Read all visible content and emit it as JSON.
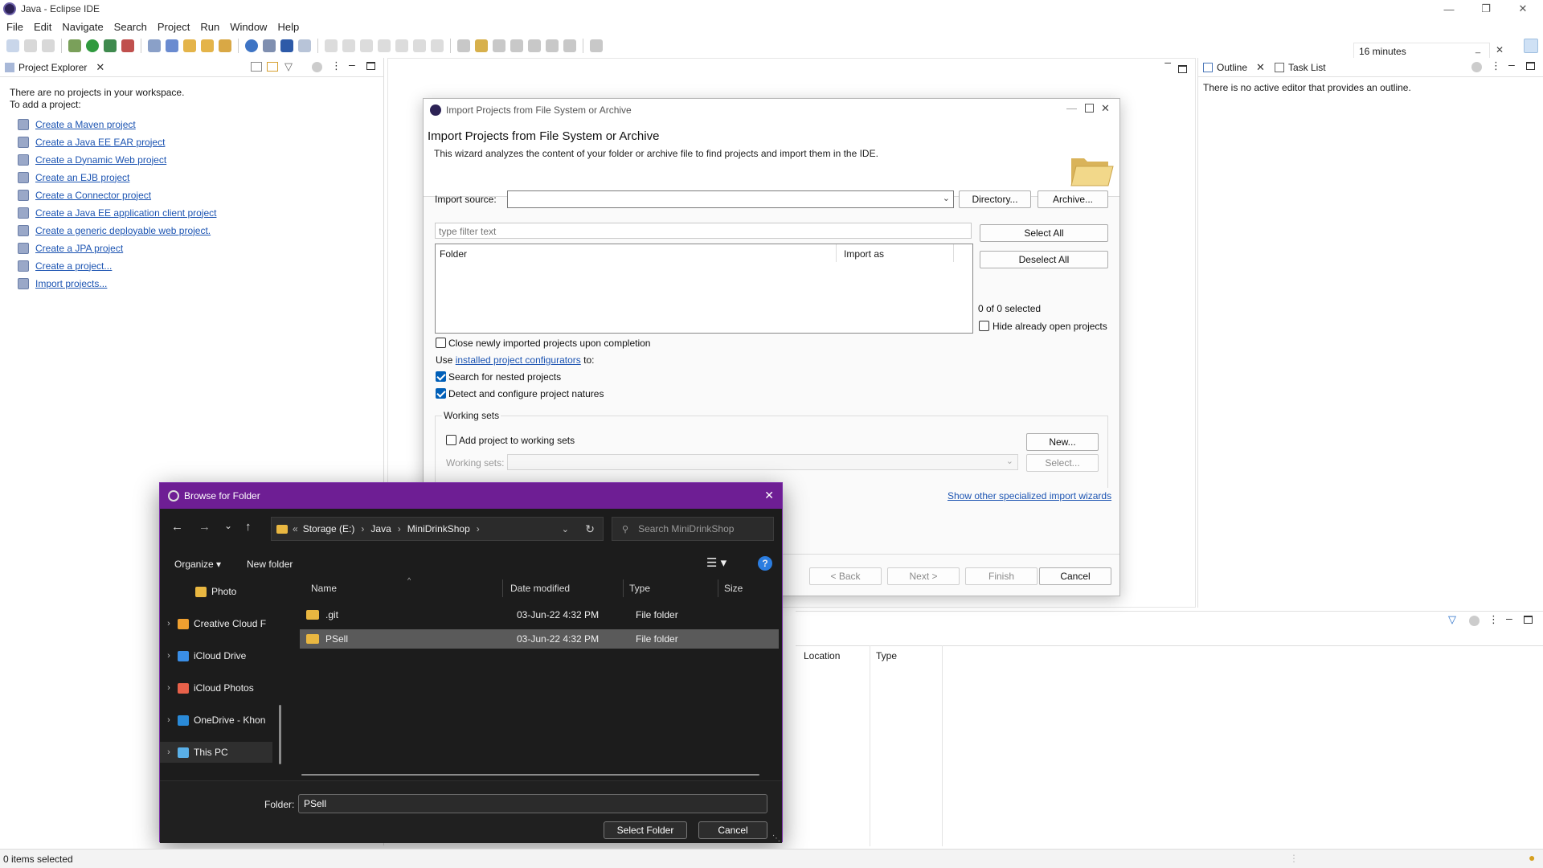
{
  "window": {
    "title": "Java - Eclipse IDE",
    "icon": "eclipse-icon"
  },
  "menu": [
    "File",
    "Edit",
    "Navigate",
    "Search",
    "Project",
    "Run",
    "Window",
    "Help"
  ],
  "quick_access": {
    "value": "16 minutes"
  },
  "project_explorer": {
    "tab_label": "Project Explorer",
    "empty_line1": "There are no projects in your workspace.",
    "empty_line2": "To add a project:",
    "links": [
      "Create a Maven project",
      "Create a Java EE EAR project",
      "Create a Dynamic Web project",
      "Create an EJB project",
      "Create a Connector project",
      "Create a Java EE application client project",
      "Create a generic deployable web project.",
      "Create a JPA project",
      "Create a project...",
      "Import projects..."
    ]
  },
  "outline": {
    "tab_outline": "Outline",
    "tab_tasks": "Task List",
    "message": "There is no active editor that provides an outline."
  },
  "bottom_panel": {
    "columns": [
      "Location",
      "Type"
    ]
  },
  "import_dialog": {
    "window_title": "Import Projects from File System or Archive",
    "heading": "Import Projects from File System or Archive",
    "description": "This wizard analyzes the content of your folder or archive file to find projects and import them in the IDE.",
    "import_source_label": "Import source:",
    "import_source_value": "",
    "directory_button": "Directory...",
    "archive_button": "Archive...",
    "filter_placeholder": "type filter text",
    "col_folder": "Folder",
    "col_import_as": "Import as",
    "select_all": "Select All",
    "deselect_all": "Deselect All",
    "selected_count": "0 of 0 selected",
    "hide_open": "Hide already open projects",
    "close_newly": "Close newly imported projects upon completion",
    "use_prefix": "Use",
    "configurators_link": "installed project configurators",
    "use_suffix": "to:",
    "search_nested": "Search for nested projects",
    "detect_natures": "Detect and configure project natures",
    "working_sets_group": "Working sets",
    "add_to_ws": "Add project to working sets",
    "new_button": "New...",
    "working_sets_label": "Working sets:",
    "select_button": "Select...",
    "other_wizards_link": "Show other specialized import wizards",
    "back_button": "< Back",
    "next_button": "Next >",
    "finish_button": "Finish",
    "cancel_button": "Cancel",
    "checks": {
      "hide_open": false,
      "close_newly": false,
      "search_nested": true,
      "detect_natures": true,
      "add_to_ws": false
    }
  },
  "browse_dialog": {
    "title": "Browse for Folder",
    "breadcrumb": [
      "Storage (E:)",
      "Java",
      "MiniDrinkShop"
    ],
    "search_placeholder": "Search MiniDrinkShop",
    "organize": "Organize",
    "new_folder": "New folder",
    "nav_items": [
      {
        "label": "Photo",
        "icon": "folder-icon",
        "color": "#e9b741"
      },
      {
        "label": "Creative Cloud F",
        "icon": "creative-cloud-icon",
        "color": "#f0a030"
      },
      {
        "label": "iCloud Drive",
        "icon": "icloud-drive-icon",
        "color": "#3a8ee6"
      },
      {
        "label": "iCloud Photos",
        "icon": "icloud-photos-icon",
        "color": "#e8614a"
      },
      {
        "label": "OneDrive - Khon",
        "icon": "onedrive-icon",
        "color": "#2a8ad8"
      },
      {
        "label": "This PC",
        "icon": "computer-icon",
        "color": "#5ab0e8"
      }
    ],
    "columns": [
      "Name",
      "Date modified",
      "Type",
      "Size"
    ],
    "files": [
      {
        "name": ".git",
        "date": "03-Jun-22 4:32 PM",
        "type": "File folder",
        "size": ""
      },
      {
        "name": "PSell",
        "date": "03-Jun-22 4:32 PM",
        "type": "File folder",
        "size": ""
      }
    ],
    "folder_label": "Folder:",
    "folder_value": "PSell",
    "select_folder": "Select Folder",
    "cancel": "Cancel",
    "title_bar_color": "#6e1e94"
  },
  "status_bar": {
    "text": "0 items selected"
  },
  "colors": {
    "link": "#1c54b2",
    "checkbox_on": "#005fb8",
    "accent": "#7b2fa8"
  }
}
